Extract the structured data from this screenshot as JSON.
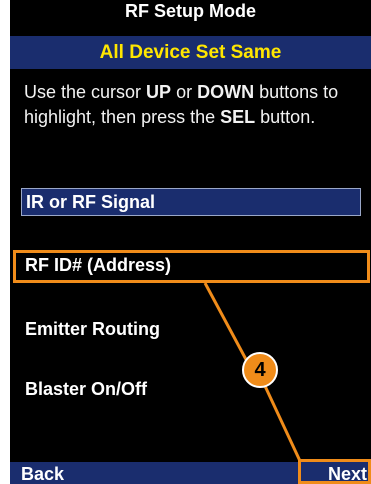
{
  "header": {
    "title": "RF Setup Mode",
    "subtitle": "All Device Set Same"
  },
  "instructions": {
    "part1": "Use the cursor ",
    "up": "UP",
    "part2": " or ",
    "down": "DOWN",
    "part3": " buttons to highlight, then press the ",
    "sel": "SEL",
    "part4": " button."
  },
  "menu": {
    "items": [
      {
        "label": "IR or RF Signal",
        "selected": true
      },
      {
        "label": "RF ID# (Address)",
        "selected": false
      },
      {
        "label": "Emitter Routing",
        "selected": false
      },
      {
        "label": "Blaster On/Off",
        "selected": false
      }
    ]
  },
  "footer": {
    "back_label": "Back",
    "next_label": "Next"
  },
  "callout": {
    "number": "4",
    "color": "#f08c1a"
  },
  "colors": {
    "accent": "#1a2d6e",
    "subtitle_text": "#ffe600"
  }
}
